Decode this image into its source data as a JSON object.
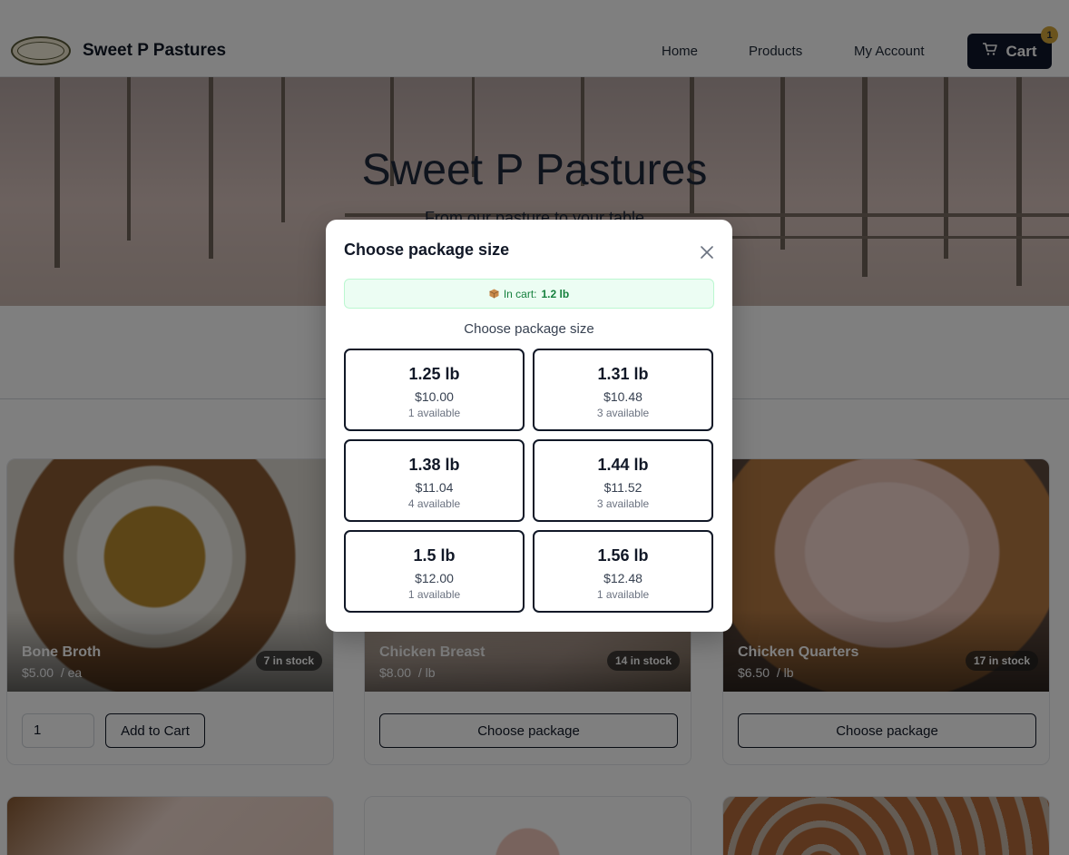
{
  "nav": {
    "brand": "Sweet P Pastures",
    "links": [
      "Home",
      "Products",
      "My Account"
    ],
    "cart_label": "Cart",
    "cart_count": "1"
  },
  "hero": {
    "title": "Sweet P Pastures",
    "subtitle": "From our pasture to your table"
  },
  "products": [
    {
      "name": "Bone Broth",
      "price": "$5.00",
      "unit": "/ ea",
      "stock": "7 in stock",
      "qty": "1",
      "action": "Add to Cart"
    },
    {
      "name": "Chicken Breast",
      "price": "$8.00",
      "unit": "/ lb",
      "stock": "14 in stock",
      "action": "Choose package"
    },
    {
      "name": "Chicken Quarters",
      "price": "$6.50",
      "unit": "/ lb",
      "stock": "17 in stock",
      "action": "Choose package"
    }
  ],
  "modal": {
    "title": "Choose package size",
    "in_cart_label": "In cart:",
    "in_cart_value": "1.2 lb",
    "subtitle": "Choose package size",
    "options": [
      {
        "weight": "1.25 lb",
        "price": "$10.00",
        "available": "1 available"
      },
      {
        "weight": "1.31 lb",
        "price": "$10.48",
        "available": "3 available"
      },
      {
        "weight": "1.38 lb",
        "price": "$11.04",
        "available": "4 available"
      },
      {
        "weight": "1.44 lb",
        "price": "$11.52",
        "available": "3 available"
      },
      {
        "weight": "1.5 lb",
        "price": "$12.00",
        "available": "1 available"
      },
      {
        "weight": "1.56 lb",
        "price": "$12.48",
        "available": "1 available"
      }
    ]
  },
  "colors": {
    "primary": "#0f172a",
    "badge": "#d4a73a",
    "success_bg": "#ecfdf3",
    "success_text": "#15803d"
  }
}
